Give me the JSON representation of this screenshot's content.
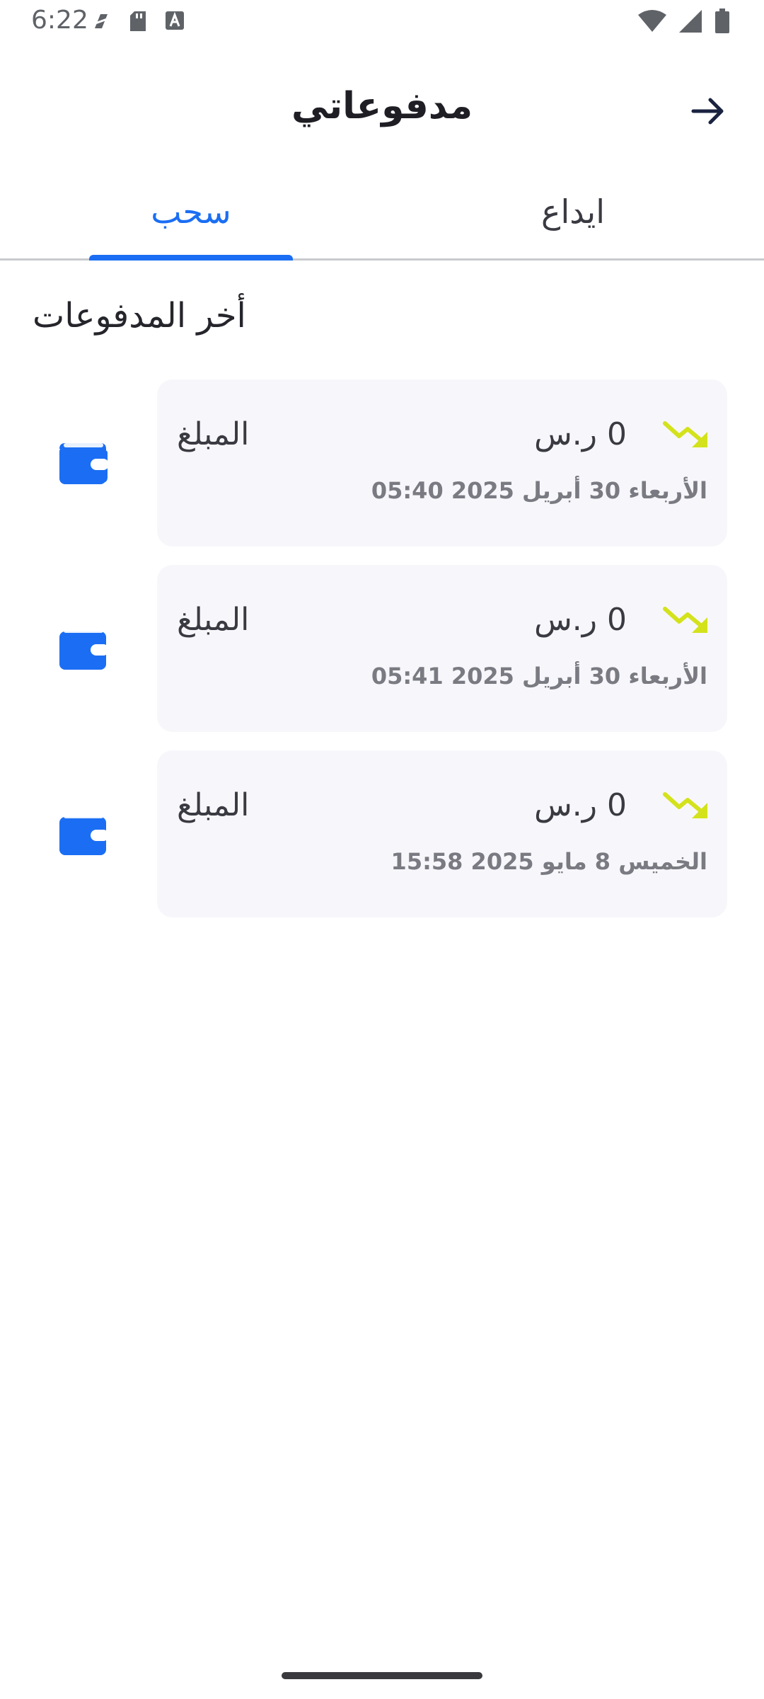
{
  "status_bar": {
    "time": "6:22",
    "left_icons": [
      "no-sim-icon",
      "sd-card-icon",
      "text-icon"
    ],
    "right_icons": [
      "wifi-icon",
      "signal-icon",
      "battery-icon"
    ]
  },
  "header": {
    "title": "مدفوعاتي",
    "back_icon": "arrow-right-icon"
  },
  "tabs": [
    {
      "label": "سحب",
      "active": true
    },
    {
      "label": "ايداع",
      "active": false
    }
  ],
  "section": {
    "title": "أخر المدفوعات"
  },
  "payments": [
    {
      "label": "المبلغ",
      "amount": "0 ر.س",
      "date": "الأربعاء 30 أبريل 2025 05:40",
      "icon": "wallet-icon",
      "trend_icon": "trending-down-icon"
    },
    {
      "label": "المبلغ",
      "amount": "0 ر.س",
      "date": "الأربعاء 30 أبريل 2025 05:41",
      "icon": "wallet-icon",
      "trend_icon": "trending-down-icon"
    },
    {
      "label": "المبلغ",
      "amount": "0 ر.س",
      "date": "الخميس 8 مايو 2025 15:58",
      "icon": "wallet-icon",
      "trend_icon": "trending-down-icon"
    }
  ],
  "colors": {
    "accent": "#1b6ef3",
    "trend": "#d4e21c",
    "card_bg": "#f7f7fb",
    "title": "#1e1e24"
  }
}
